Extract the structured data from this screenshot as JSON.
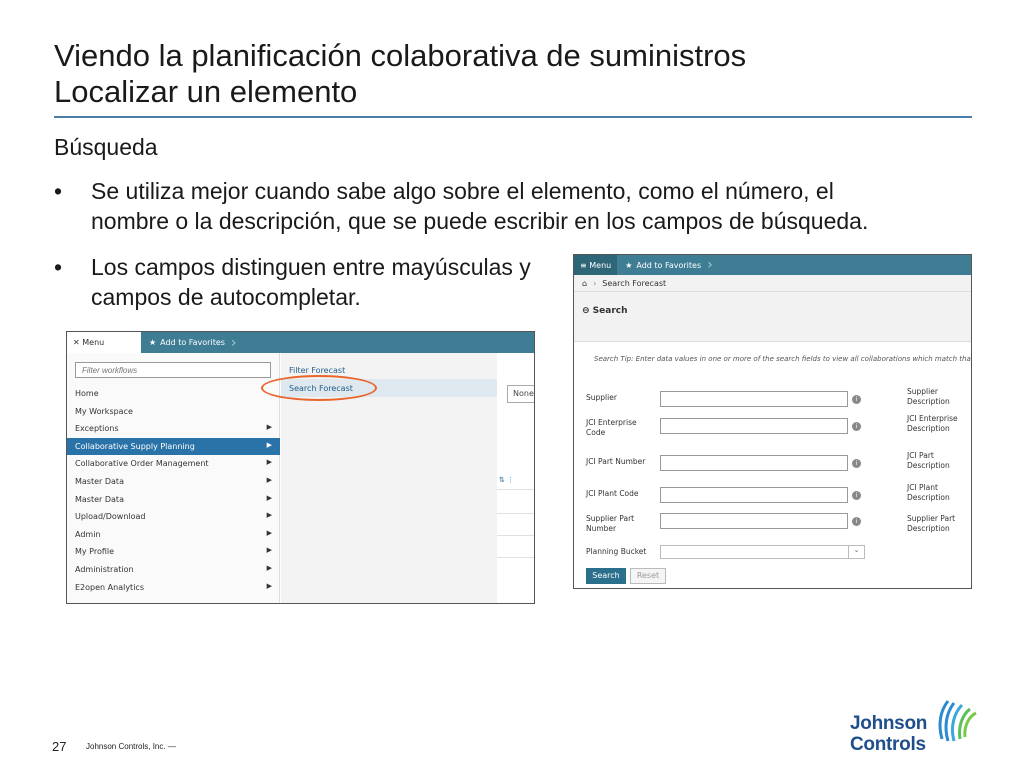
{
  "slide": {
    "title_line1": "Viendo la planificación colaborativa de suministros",
    "title_line2": "Localizar un elemento",
    "subtitle": "Búsqueda",
    "bullets": [
      {
        "marker": "•",
        "line1": "Se utiliza mejor cuando sabe algo sobre el elemento, como el número, el",
        "line2": "nombre o la descripción, que se puede escribir en los campos de búsqueda."
      },
      {
        "marker": "•",
        "line1": "Los campos distinguen entre mayúsculas y",
        "line2": "campos de autocompletar."
      }
    ],
    "page_number": "27",
    "footer": "Johnson Controls, Inc. —",
    "logo": {
      "line1": "Johnson",
      "line2": "Controls"
    }
  },
  "menu_shot": {
    "menu_label": "✕ Menu",
    "favorites_label": "Add to Favorites",
    "filter_placeholder": "Filter workflows",
    "items": [
      {
        "label": "Home",
        "arrow": ""
      },
      {
        "label": "My Workspace",
        "arrow": ""
      },
      {
        "label": "Exceptions",
        "arrow": "▶"
      },
      {
        "label": "Collaborative Supply Planning",
        "arrow": "▶"
      },
      {
        "label": "Collaborative Order Management",
        "arrow": "▶"
      },
      {
        "label": "Master Data",
        "arrow": "▶"
      },
      {
        "label": "Master Data",
        "arrow": "▶"
      },
      {
        "label": "Upload/Download",
        "arrow": "▶"
      },
      {
        "label": "Admin",
        "arrow": "▶"
      },
      {
        "label": "My Profile",
        "arrow": "▶"
      },
      {
        "label": "Administration",
        "arrow": "▶"
      },
      {
        "label": "E2open Analytics",
        "arrow": "▶"
      }
    ],
    "sub_items": [
      "Filter Forecast",
      "Search Forecast"
    ],
    "none_button": "None",
    "strip_icons": "⇅  ⋮"
  },
  "search_shot": {
    "menu_label": "≡ Menu",
    "favorites_label": "Add to Favorites",
    "breadcrumb": "Search Forecast",
    "section_label": "⊖ Search",
    "tip": "Search Tip: Enter data values in one or more of the search fields to view all collaborations which match that criteria",
    "fields": [
      {
        "label": "Supplier",
        "right": "Supplier Description"
      },
      {
        "label": "JCI Enterprise Code",
        "right": "JCI Enterprise Description"
      },
      {
        "label": "JCI Part Number",
        "right": "JCI Part Description"
      },
      {
        "label": "JCI Plant Code",
        "right": "JCI Plant Description"
      },
      {
        "label": "Supplier Part Number",
        "right": "Supplier Part Description"
      }
    ],
    "planning_bucket_label": "Planning Bucket",
    "search_button": "Search",
    "reset_button": "Reset"
  },
  "colors": {
    "accent": "#3e7d94",
    "highlight_circle": "#e8652d",
    "brand": "#1f4e8c"
  }
}
